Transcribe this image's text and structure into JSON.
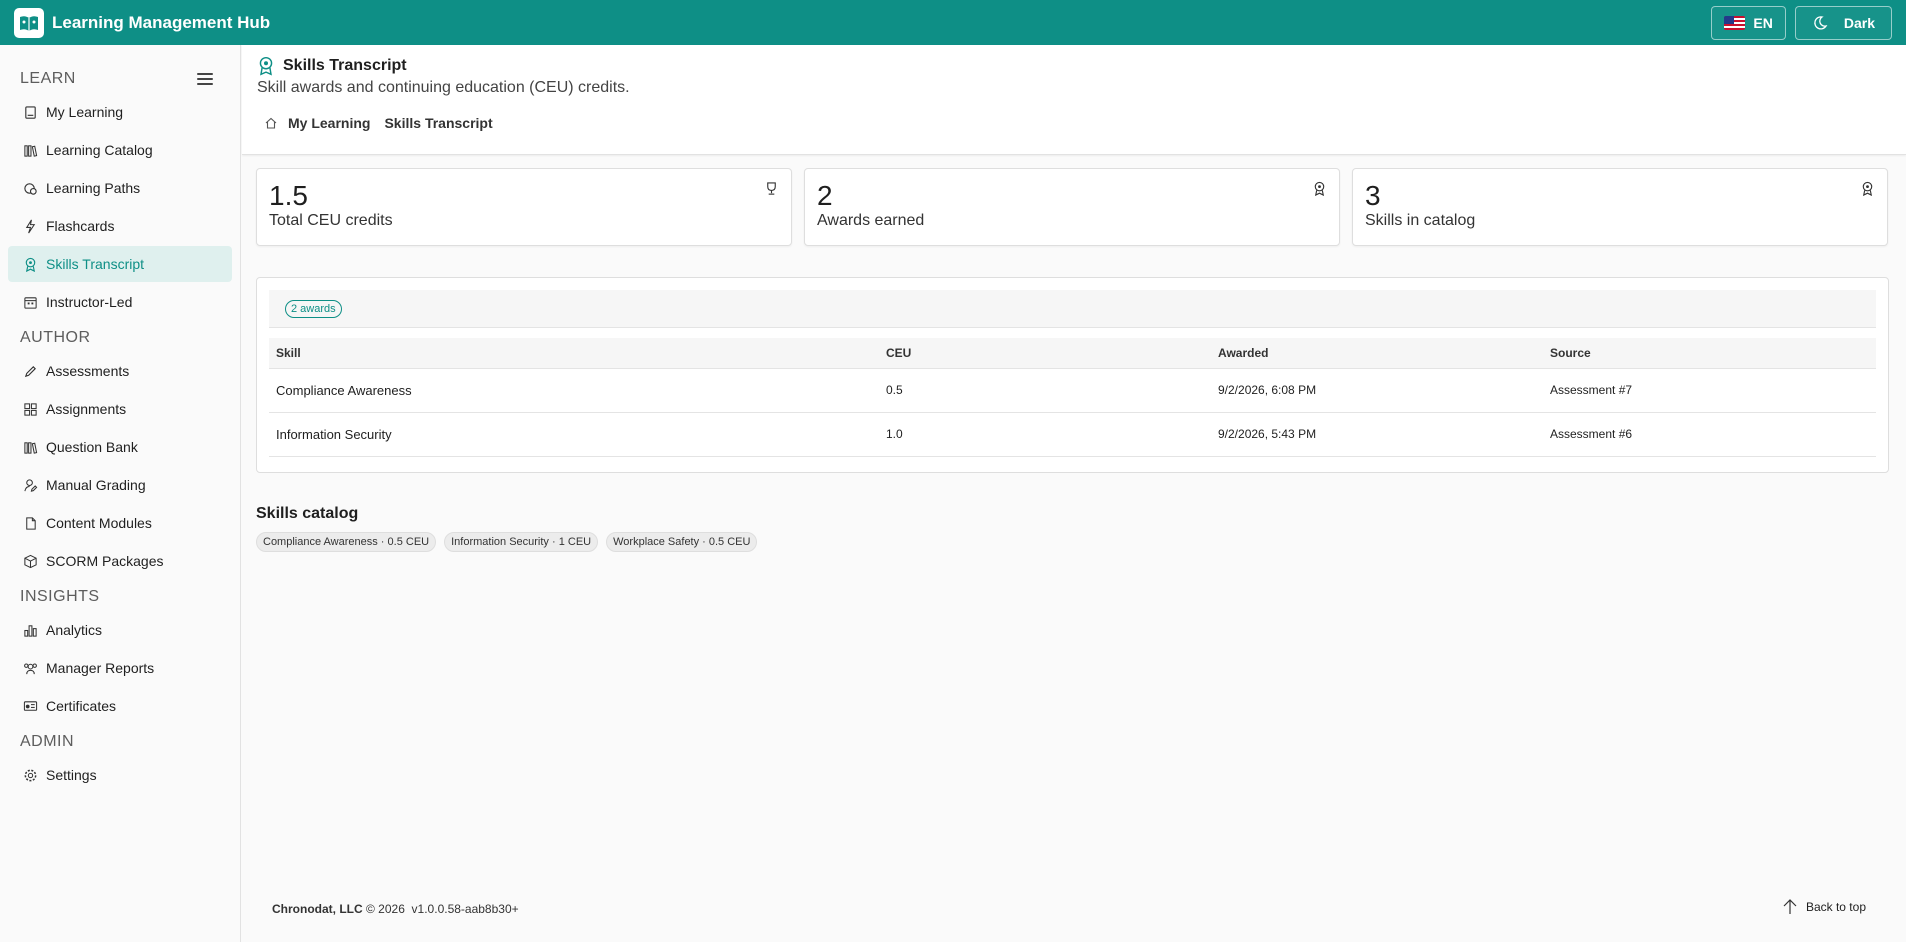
{
  "app": {
    "title": "Learning Management Hub"
  },
  "topbar": {
    "language_label": "EN",
    "theme_label": "Dark"
  },
  "sidebar": {
    "sections": [
      {
        "heading": "LEARN",
        "items": [
          {
            "label": "My Learning",
            "icon": "book-icon"
          },
          {
            "label": "Learning Catalog",
            "icon": "library-icon"
          },
          {
            "label": "Learning Paths",
            "icon": "path-icon"
          },
          {
            "label": "Flashcards",
            "icon": "flash-icon"
          },
          {
            "label": "Skills Transcript",
            "icon": "award-icon",
            "active": true
          },
          {
            "label": "Instructor-Led",
            "icon": "calendar-icon"
          }
        ]
      },
      {
        "heading": "AUTHOR",
        "items": [
          {
            "label": "Assessments",
            "icon": "pencil-icon"
          },
          {
            "label": "Assignments",
            "icon": "grid-icon"
          },
          {
            "label": "Question Bank",
            "icon": "library-icon"
          },
          {
            "label": "Manual Grading",
            "icon": "person-edit-icon"
          },
          {
            "label": "Content Modules",
            "icon": "document-icon"
          },
          {
            "label": "SCORM Packages",
            "icon": "cube-icon"
          }
        ]
      },
      {
        "heading": "INSIGHTS",
        "items": [
          {
            "label": "Analytics",
            "icon": "chart-icon"
          },
          {
            "label": "Manager Reports",
            "icon": "people-icon"
          },
          {
            "label": "Certificates",
            "icon": "certificate-icon"
          }
        ]
      },
      {
        "heading": "ADMIN",
        "items": [
          {
            "label": "Settings",
            "icon": "gear-icon"
          }
        ]
      }
    ]
  },
  "page": {
    "title": "Skills Transcript",
    "subtitle": "Skill awards and continuing education (CEU) credits.",
    "breadcrumb": [
      "My Learning",
      "Skills Transcript"
    ]
  },
  "stats": [
    {
      "value": "1.5",
      "label": "Total CEU credits",
      "icon": "trophy-icon"
    },
    {
      "value": "2",
      "label": "Awards earned",
      "icon": "award-icon"
    },
    {
      "value": "3",
      "label": "Skills in catalog",
      "icon": "award-icon"
    }
  ],
  "awards": {
    "badge": "2 awards",
    "columns": [
      "Skill",
      "CEU",
      "Awarded",
      "Source"
    ],
    "rows": [
      [
        "Compliance Awareness",
        "0.5",
        "9/2/2026, 6:08 PM",
        "Assessment #7"
      ],
      [
        "Information Security",
        "1.0",
        "9/2/2026, 5:43 PM",
        "Assessment #6"
      ]
    ]
  },
  "catalog": {
    "title": "Skills catalog",
    "chips": [
      "Compliance Awareness · 0.5 CEU",
      "Information Security · 1 CEU",
      "Workplace Safety · 0.5 CEU"
    ]
  },
  "footer": {
    "company": "Chronodat, LLC",
    "copyright": "© 2026",
    "version": "v1.0.0.58-aab8b30+",
    "back_to_top": "Back to top"
  },
  "colors": {
    "accent": "#0e8f86",
    "active_bg": "#dff0ee"
  }
}
